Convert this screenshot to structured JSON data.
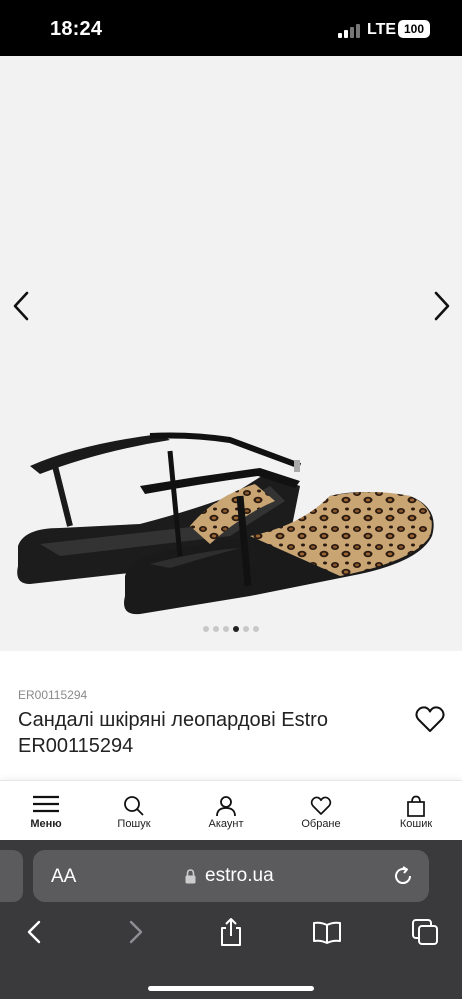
{
  "status_bar": {
    "time": "18:24",
    "network": "LTE",
    "battery": "100"
  },
  "gallery": {
    "slide_count": 6,
    "active_slide": 4
  },
  "product": {
    "sku": "ER00115294",
    "title": "Сандалі шкіряні леопардові Estro ER00115294"
  },
  "bottom_nav": {
    "items": [
      {
        "label": "Меню",
        "icon": "menu-icon"
      },
      {
        "label": "Пошук",
        "icon": "search-icon"
      },
      {
        "label": "Акаунт",
        "icon": "account-icon"
      },
      {
        "label": "Обране",
        "icon": "heart-icon"
      },
      {
        "label": "Кошик",
        "icon": "bag-icon"
      }
    ]
  },
  "browser": {
    "aa_label": "AA",
    "url": "estro.ua"
  },
  "colors": {
    "accent": "#000000",
    "safari_bar": "#3a3a3c",
    "gallery_bg": "#f2f2f2"
  }
}
